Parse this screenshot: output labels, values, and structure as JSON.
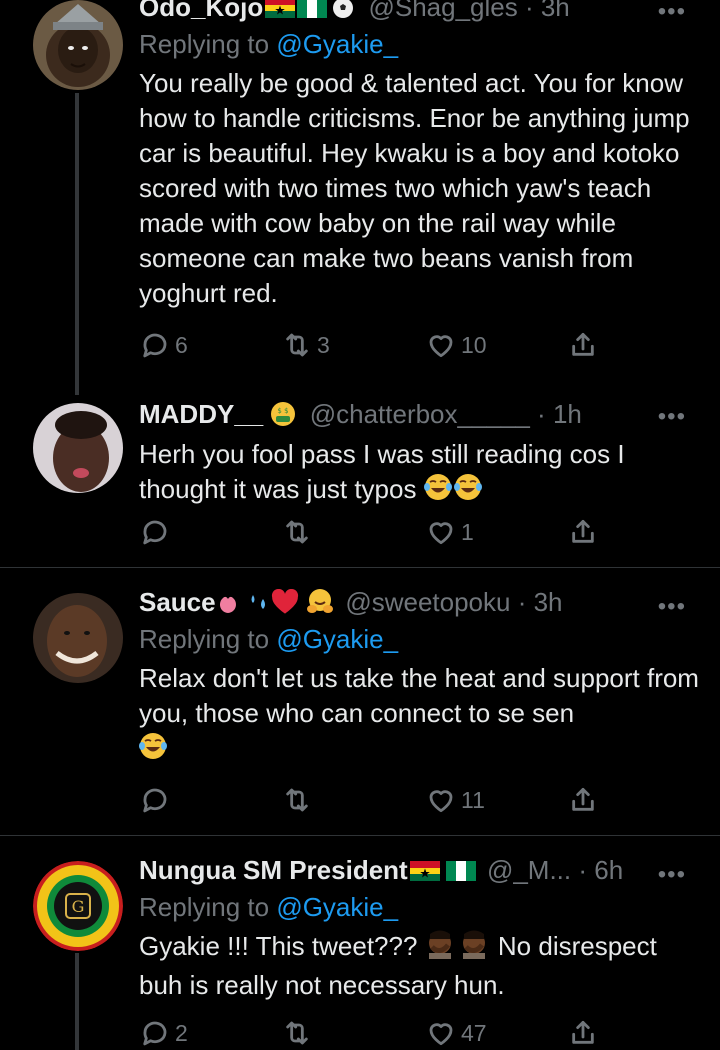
{
  "tweets": [
    {
      "name": "Odo_Kojo",
      "handle": "@Shag_gles",
      "time": "3h",
      "replying_prefix": "Replying to ",
      "replying_to": "@Gyakie_",
      "text": "You really be good & talented act. You for know how to handle criticisms. Enor be anything jump car is beautiful. Hey kwaku is a boy and kotoko scored with two times two which yaw's teach made with cow baby on the rail way while someone can make two beans vanish from yoghurt red.",
      "replies": "6",
      "retweets": "3",
      "likes": "10"
    },
    {
      "name": "MADDY__",
      "handle": "@chatterbox_____",
      "time": "1h",
      "text": "Herh you fool pass I was still reading cos I thought it was just typos",
      "replies": "",
      "retweets": "",
      "likes": "1"
    },
    {
      "name": "Sauce",
      "handle": "@sweetopoku",
      "time": "3h",
      "replying_prefix": "Replying to ",
      "replying_to": "@Gyakie_",
      "text": "Relax don't let us take the heat and support from you, those who can connect to se sen",
      "replies": "",
      "retweets": "",
      "likes": "11"
    },
    {
      "name": "Nungua SM President",
      "handle": "@_M...",
      "time": "6h",
      "replying_prefix": "Replying to ",
      "replying_to": "@Gyakie_",
      "text_a": "Gyakie !!! This tweet???",
      "text_b": "No disrespect buh is really not necessary hun.",
      "replies": "2",
      "retweets": "",
      "likes": "47"
    }
  ],
  "sep": " · ",
  "colors": {
    "background": "#000000",
    "text": "#e7e9ea",
    "muted": "#71767b",
    "link": "#1d9bf0",
    "divider": "#2f3336"
  }
}
